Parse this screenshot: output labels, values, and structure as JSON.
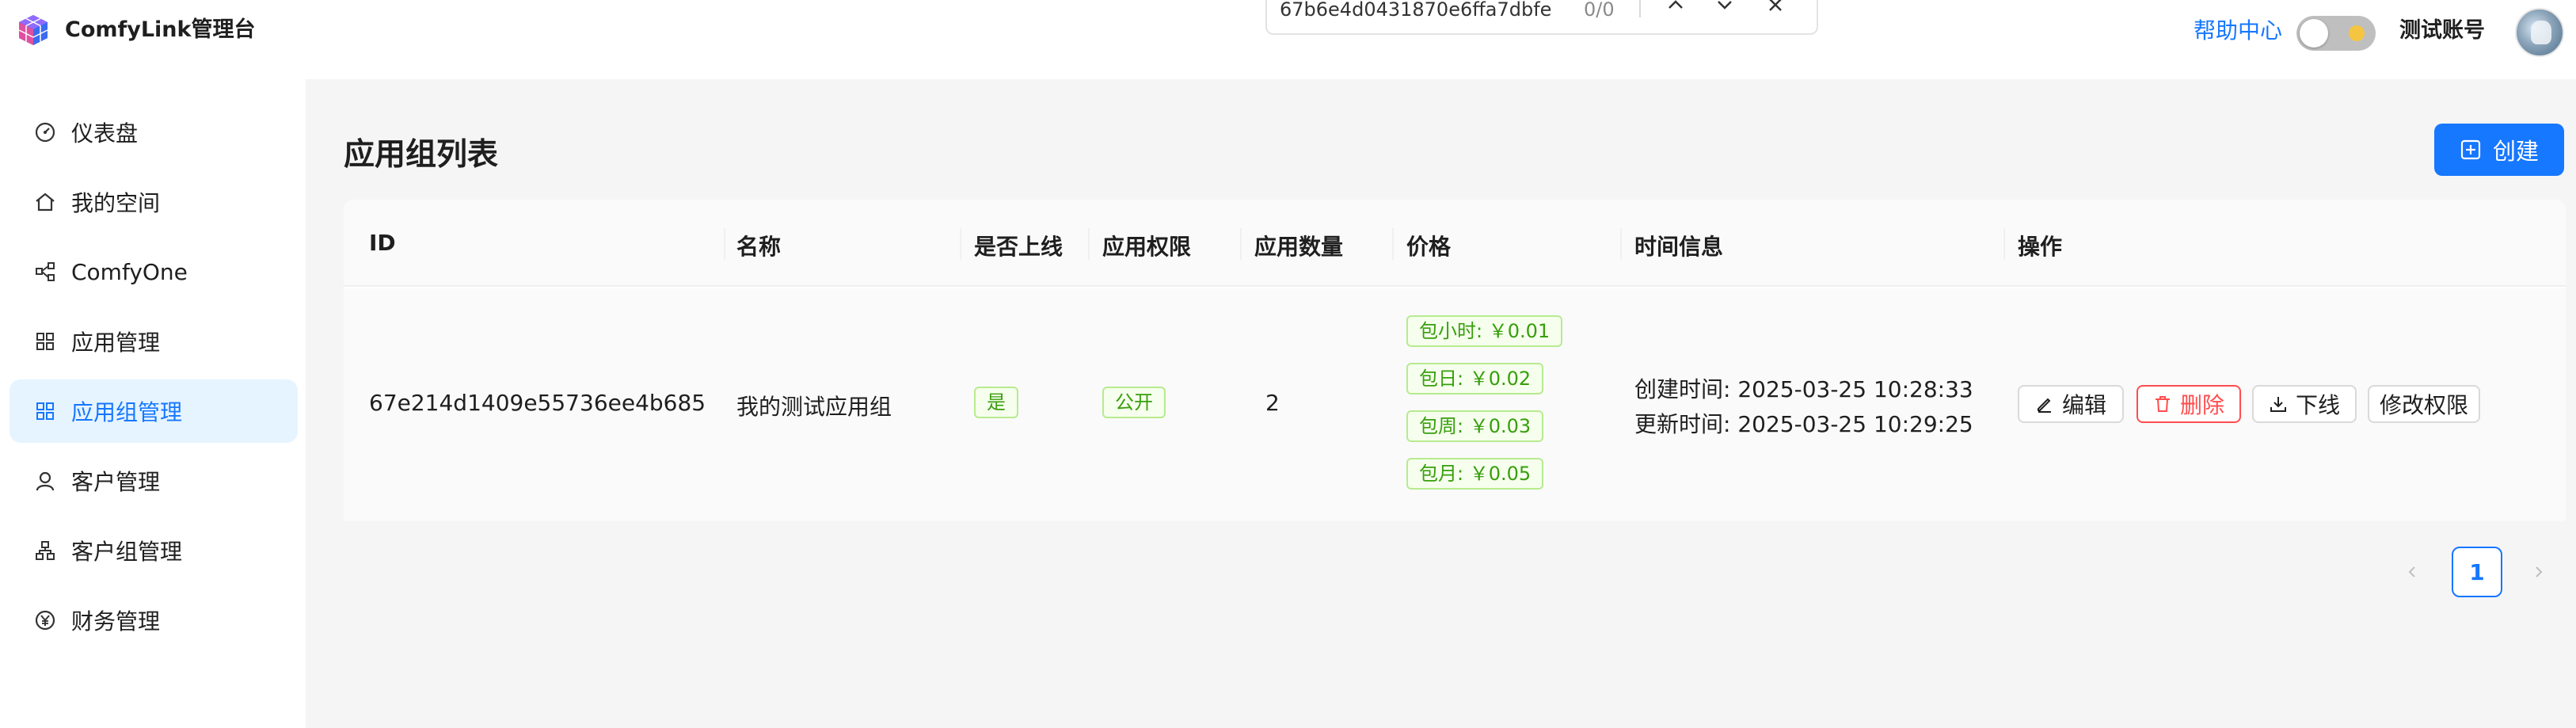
{
  "header": {
    "app_title": "ComfyLink管理台",
    "help_label": "帮助中心",
    "account_name": "测试账号"
  },
  "findbar": {
    "query": "67b6e4d0431870e6ffa7dbfe",
    "count": "0/0"
  },
  "sidebar": {
    "items": [
      {
        "label": "仪表盘",
        "icon": "dashboard-icon"
      },
      {
        "label": "我的空间",
        "icon": "home-icon"
      },
      {
        "label": "ComfyOne",
        "icon": "nodes-icon"
      },
      {
        "label": "应用管理",
        "icon": "apps-icon"
      },
      {
        "label": "应用组管理",
        "icon": "apps-icon",
        "active": true
      },
      {
        "label": "客户管理",
        "icon": "user-icon"
      },
      {
        "label": "客户组管理",
        "icon": "org-icon"
      },
      {
        "label": "财务管理",
        "icon": "yen-icon"
      }
    ]
  },
  "main": {
    "page_title": "应用组列表",
    "create_label": "创建"
  },
  "table": {
    "columns": [
      "ID",
      "名称",
      "是否上线",
      "应用权限",
      "应用数量",
      "价格",
      "时间信息",
      "操作"
    ],
    "rows": [
      {
        "id": "67e214d1409e55736ee4b685",
        "name": "我的测试应用组",
        "online": "是",
        "permission": "公开",
        "app_count": "2",
        "prices": [
          "包小时: ￥0.01",
          "包日: ￥0.02",
          "包周: ￥0.03",
          "包月: ￥0.05"
        ],
        "created": "创建时间: 2025-03-25 10:28:33",
        "updated": "更新时间: 2025-03-25 10:29:25",
        "actions": {
          "edit": "编辑",
          "delete": "删除",
          "offline": "下线",
          "permissions": "修改权限"
        }
      }
    ]
  },
  "pagination": {
    "current_page": "1"
  },
  "colors": {
    "primary": "#1677ff",
    "danger": "#ff4d4f",
    "success": "#389e0d",
    "active_bg": "#e6f4ff"
  }
}
